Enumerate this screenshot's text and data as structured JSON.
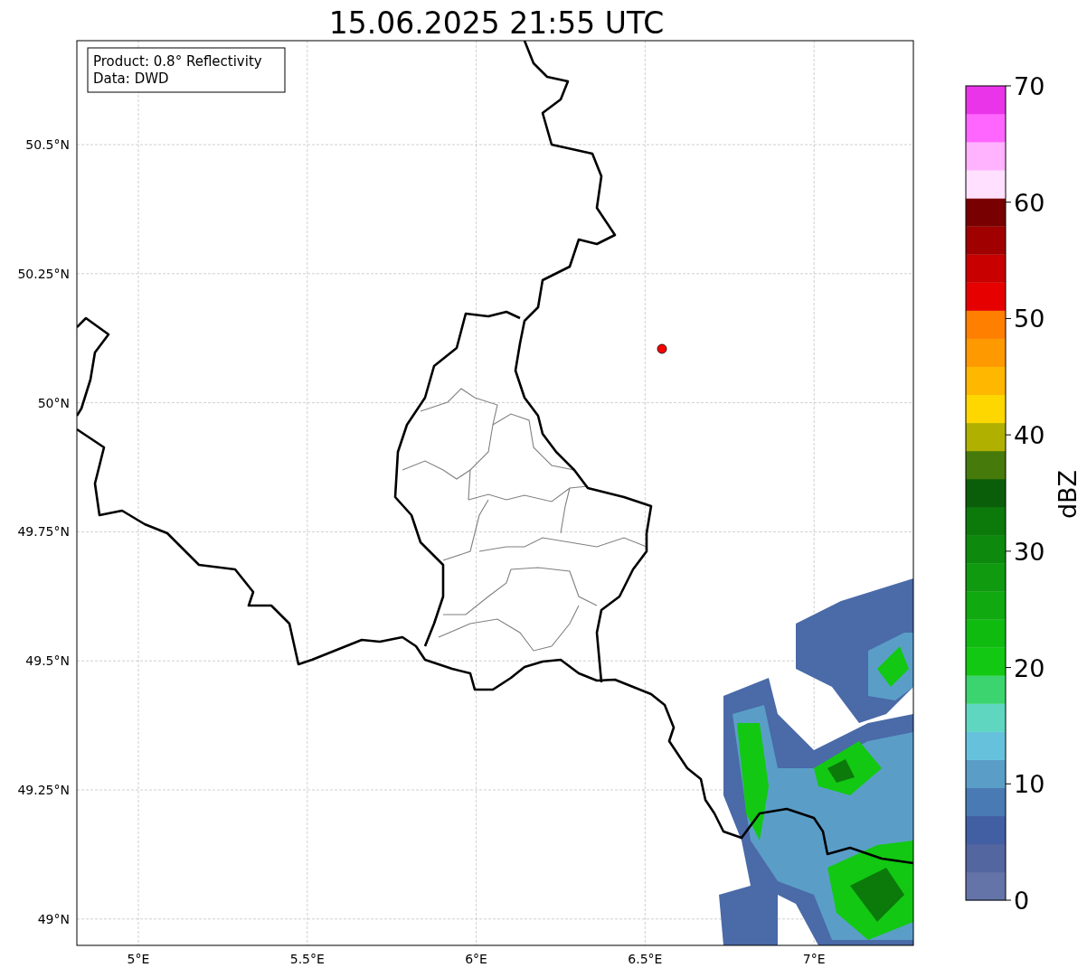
{
  "title": "15.06.2025 21:55 UTC",
  "legend": [
    "Product: 0.8° Reflectivity",
    "Data: DWD"
  ],
  "map": {
    "lon_ticks": [
      "5°E",
      "5.5°E",
      "6°E",
      "6.5°E",
      "7°E"
    ],
    "lat_ticks": [
      "50.5°N",
      "50.25°N",
      "50°N",
      "49.75°N",
      "49.5°N",
      "49.25°N",
      "49°N"
    ]
  },
  "colorbar": {
    "label": "dBZ",
    "ticks": [
      "70",
      "60",
      "50",
      "40",
      "30",
      "20",
      "10",
      "0"
    ],
    "bins": [
      {
        "color": "#6474a8"
      },
      {
        "color": "#5466a0"
      },
      {
        "color": "#435fa3"
      },
      {
        "color": "#4a7ab4"
      },
      {
        "color": "#5a9ec8"
      },
      {
        "color": "#66c2dc"
      },
      {
        "color": "#5ed6c0"
      },
      {
        "color": "#3cd46e"
      },
      {
        "color": "#12c812"
      },
      {
        "color": "#10bb10"
      },
      {
        "color": "#10aa10"
      },
      {
        "color": "#0f9a0f"
      },
      {
        "color": "#0d8a0d"
      },
      {
        "color": "#0b7a0b"
      },
      {
        "color": "#0a5e0a"
      },
      {
        "color": "#467a0a"
      },
      {
        "color": "#b0b000"
      },
      {
        "color": "#ffd700"
      },
      {
        "color": "#ffb700"
      },
      {
        "color": "#ff9900"
      },
      {
        "color": "#ff7f00"
      },
      {
        "color": "#e60000"
      },
      {
        "color": "#c80000"
      },
      {
        "color": "#a00000"
      },
      {
        "color": "#780000"
      },
      {
        "color": "#ffe0ff"
      },
      {
        "color": "#ffb3ff"
      },
      {
        "color": "#ff66ff"
      },
      {
        "color": "#e934e9"
      }
    ]
  }
}
